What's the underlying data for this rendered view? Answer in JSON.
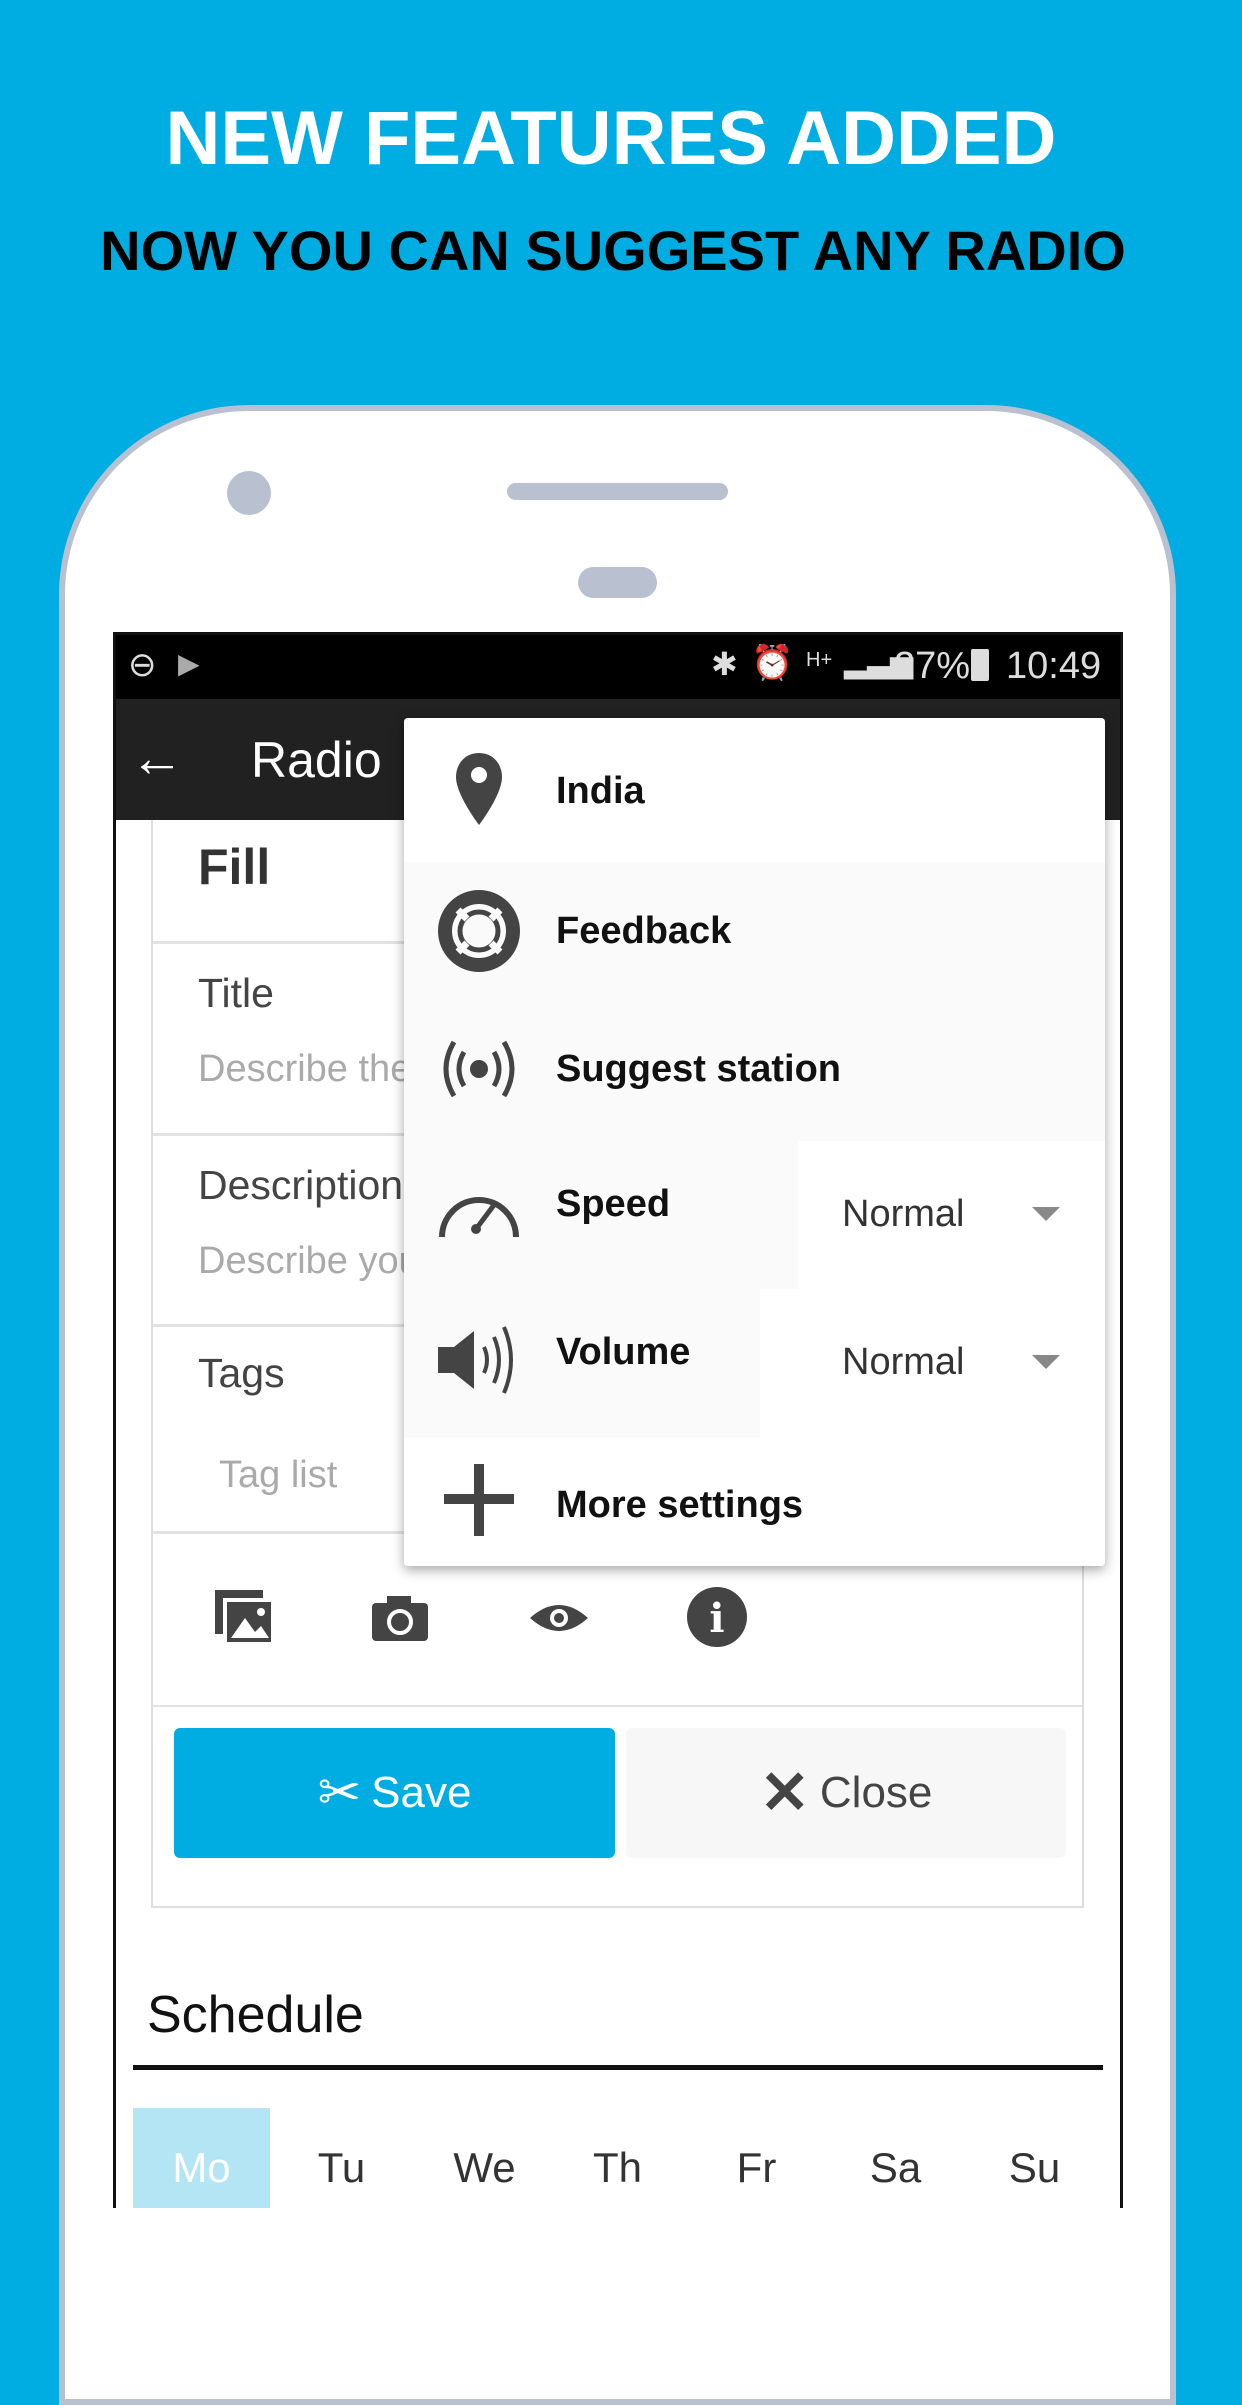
{
  "promo": {
    "headline": "NEW FEATURES ADDED",
    "subheadline": "NOW YOU CAN SUGGEST ANY RADIO"
  },
  "status_bar": {
    "battery": "27%",
    "time": "10:49",
    "network": "H+"
  },
  "app_bar": {
    "title": "Radio"
  },
  "form": {
    "heading": "Fill",
    "title_label": "Title",
    "title_placeholder": "Describe the",
    "description_label": "Description",
    "description_placeholder": "Describe you",
    "tags_label": "Tags",
    "tags_placeholder": "Tag list",
    "save_label": "Save",
    "close_label": "Close"
  },
  "menu": {
    "items": [
      {
        "label": "India",
        "icon": "location-pin-icon"
      },
      {
        "label": "Feedback",
        "icon": "lifebuoy-icon"
      },
      {
        "label": "Suggest station",
        "icon": "broadcast-icon"
      },
      {
        "label": "Speed",
        "icon": "speedometer-icon",
        "value": "Normal"
      },
      {
        "label": "Volume",
        "icon": "volume-icon",
        "value": "Normal"
      },
      {
        "label": "More settings",
        "icon": "plus-icon"
      }
    ]
  },
  "schedule": {
    "title": "Schedule",
    "days": [
      "Mo",
      "Tu",
      "We",
      "Th",
      "Fr",
      "Sa",
      "Su"
    ],
    "selected": "Mo"
  },
  "colors": {
    "accent": "#00ade3",
    "selected_day": "#b3e5f5",
    "app_bar": "#212121"
  }
}
